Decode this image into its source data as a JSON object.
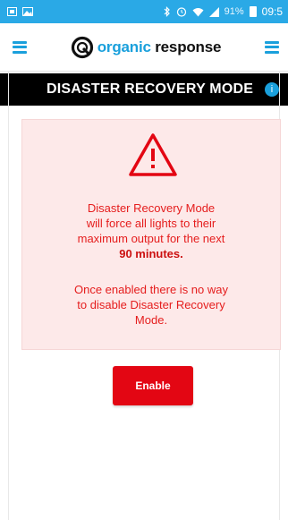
{
  "status_bar": {
    "battery": "91%",
    "time": "09:5",
    "icons": [
      "screenshot-icon",
      "gallery-icon",
      "bluetooth-icon",
      "alarm-icon",
      "wifi-icon",
      "signal-icon",
      "battery-icon"
    ],
    "color": "#2aa9e6"
  },
  "header": {
    "logo_word_1": "organic",
    "logo_word_2": "response",
    "accent_color": "#1aa0dc"
  },
  "title_bar": {
    "title": "DISASTER RECOVERY MODE"
  },
  "warning": {
    "line1": "Disaster Recovery Mode",
    "line2": "will force all lights to their",
    "line3": "maximum output for the next",
    "duration": "90 minutes",
    "duration_suffix": ".",
    "note_line1": "Once enabled there is no way",
    "note_line2": "to disable Disaster Recovery",
    "note_line3": "Mode.",
    "text_color": "#e51d1d",
    "panel_color": "#fde9e9"
  },
  "actions": {
    "enable_label": "Enable",
    "button_color": "#e30613"
  }
}
